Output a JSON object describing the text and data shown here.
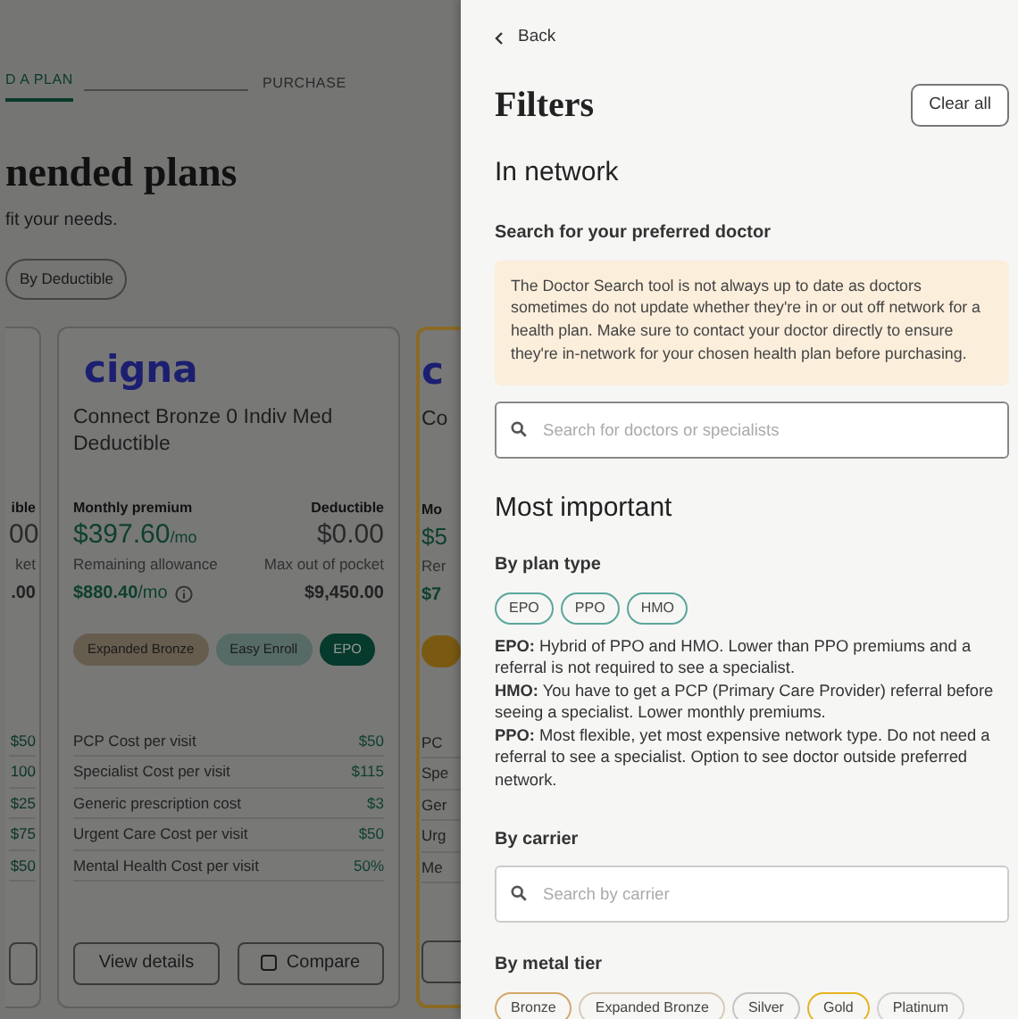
{
  "background_page": {
    "stepper": [
      {
        "label": "D A PLAN",
        "selected": true
      },
      {
        "label": "PURCHASE",
        "selected": false
      }
    ],
    "heading": "nended plans",
    "subheading": "fit your needs.",
    "sort_chips": [
      "By Deductible"
    ],
    "left_card_fragment": {
      "header_label": "ible",
      "premium": "00",
      "allowance_label": "ket",
      "allowance": ".00",
      "rows": [
        "$50",
        "100",
        "$25",
        "$75",
        "$50"
      ]
    },
    "plan_card": {
      "logo_text": "cigna",
      "title": "Connect Bronze 0 Indiv Med Deductible",
      "premium_label": "Monthly premium",
      "premium": "$397.60",
      "premium_unit": "/mo",
      "deductible_label": "Deductible",
      "deductible": "$0.00",
      "allowance_label": "Remaining allowance",
      "allowance": "$880.40",
      "allowance_unit": "/mo",
      "max_label": "Max out of pocket",
      "max": "$9,450.00",
      "tags": [
        {
          "label": "Expanded Bronze",
          "color": "#675d4f"
        },
        {
          "label": "Easy Enroll",
          "color": "#566b66"
        },
        {
          "label": "EPO",
          "color": "#063a2c"
        }
      ],
      "rows": [
        {
          "label": "PCP Cost per visit",
          "value": "$50"
        },
        {
          "label": "Specialist Cost per visit",
          "value": "$115"
        },
        {
          "label": "Generic prescription cost",
          "value": "$3"
        },
        {
          "label": "Urgent Care Cost per visit",
          "value": "$50"
        },
        {
          "label": "Mental Health Cost per visit",
          "value": "50%"
        }
      ],
      "buttons": [
        "View details",
        "Compare"
      ],
      "compare_checked": false
    },
    "right_card_fragment": {
      "logo_text": "c",
      "title": "Co",
      "header_label": "Mo",
      "premium": "$5",
      "allowance_label": "Rer",
      "allowance": "$7",
      "tags": [
        {
          "color": "#7a5a12"
        }
      ],
      "rows": [
        "PC",
        "Spe",
        "Ger",
        "Urg",
        "Me"
      ]
    }
  },
  "filters": {
    "back": "Back",
    "title": "Filters",
    "clear_all": "Clear all",
    "in_network": {
      "heading": "In network",
      "label": "Search for your preferred doctor",
      "notice": "The Doctor Search tool is not always up to date as doctors sometimes do not update whether they're in or out off network for a health plan. Make sure to contact your doctor directly to ensure they're in-network for your chosen health plan before purchasing.",
      "search": {
        "placeholder": "Search for doctors or specialists"
      }
    },
    "most_important": "Most important",
    "plan_type": {
      "heading": "By plan type",
      "chips": [
        "EPO",
        "PPO",
        "HMO"
      ],
      "descriptions": [
        "**EPO:** Hybrid of PPO and HMO. Lower than PPO premiums and a referral is not required to see a specialist.",
        "**HMO:** You have to get a PCP (Primary Care Provider) referral before seeing a specialist. Lower monthly premiums.",
        "**PPO:** Most flexible, yet most expensive network type. Do not need a referral to see a specialist. Option to see doctor outside preferred network."
      ]
    },
    "carrier": {
      "heading": "By carrier",
      "search": {
        "placeholder": "Search by carrier"
      }
    },
    "metal_tier": {
      "heading": "By metal tier",
      "chips": [
        {
          "label": "Bronze",
          "color": "#d4a86a"
        },
        {
          "label": "Expanded Bronze",
          "color": "#d9cbb5"
        },
        {
          "label": "Silver",
          "color": "#c4c4c4"
        },
        {
          "label": "Gold",
          "color": "#e6b422"
        },
        {
          "label": "Platinum",
          "color": "#d0d0d0"
        }
      ]
    }
  }
}
